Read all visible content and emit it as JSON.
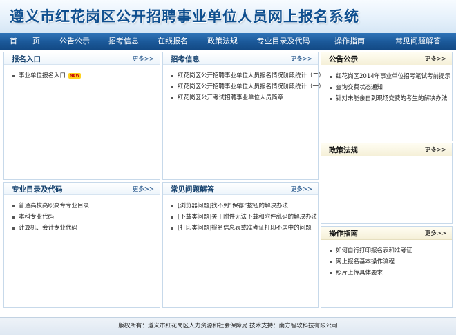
{
  "header": {
    "title": "遵义市红花岗区公开招聘事业单位人员网上报名系统"
  },
  "nav": [
    {
      "label": "首　　页"
    },
    {
      "label": "公告公示"
    },
    {
      "label": "招考信息"
    },
    {
      "label": "在线报名"
    },
    {
      "label": "政策法规"
    },
    {
      "label": "专业目录及代码"
    },
    {
      "label": "操作指南"
    },
    {
      "label": "常见问题解答"
    }
  ],
  "more_label": "更多>>",
  "panels": {
    "registration": {
      "title": "报名入口",
      "items": [
        "事业单位报名入口"
      ],
      "badge": "NEW"
    },
    "exam_info": {
      "title": "招考信息",
      "items": [
        "红花岗区公开招聘事业单位人员报名情况阶段统计（二）",
        "红花岗区公开招聘事业单位人员报名情况阶段统计（一）",
        "红花岗区公开考试招聘事业单位人员简章"
      ]
    },
    "announcements": {
      "title": "公告公示",
      "items": [
        "红花岗区2014年事业单位招考笔试考前提示",
        "查询交费状态通知",
        "针对未能亲自到现场交费的考生的解决办法"
      ]
    },
    "policies": {
      "title": "政策法规",
      "items": []
    },
    "majors": {
      "title": "专业目录及代码",
      "items": [
        "普通高校高职高专专业目录",
        "本科专业代码",
        "计算机、会计专业代码"
      ]
    },
    "faq": {
      "title": "常见问题解答",
      "items": [
        "[浏览器问题]找不到“保存”按钮的解决办法",
        "[下载类问题]关于附件无法下载和附件乱码的解决办法",
        "[打印类问题]报名信息表或准考证打印不居中的问题"
      ]
    },
    "guide": {
      "title": "操作指南",
      "items": [
        "如何自行打印报名表和准考证",
        "网上报名基本操作流程",
        "照片上传具体要求"
      ]
    }
  },
  "footer": {
    "text": "版权所有：遵义市红花岗区人力资源和社会保障局  技术支持：南方智软科技有限公司"
  }
}
